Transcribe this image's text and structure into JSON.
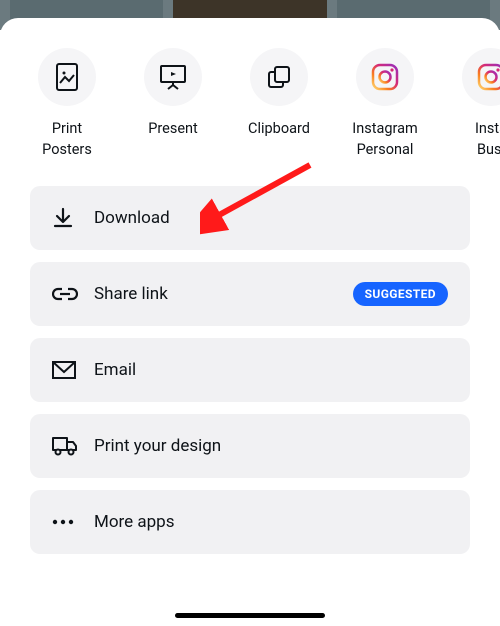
{
  "destinations": [
    {
      "icon": "poster-icon",
      "label": "Print\nPosters"
    },
    {
      "icon": "present-icon",
      "label": "Present"
    },
    {
      "icon": "clipboard-icon",
      "label": "Clipboard"
    },
    {
      "icon": "instagram-icon",
      "label": "Instagram\nPersonal"
    },
    {
      "icon": "instagram-icon",
      "label": "Insta\nBusi"
    }
  ],
  "actions": {
    "download": "Download",
    "sharelink": "Share link",
    "badge": "SUGGESTED",
    "email": "Email",
    "print": "Print your design",
    "more": "More apps"
  }
}
